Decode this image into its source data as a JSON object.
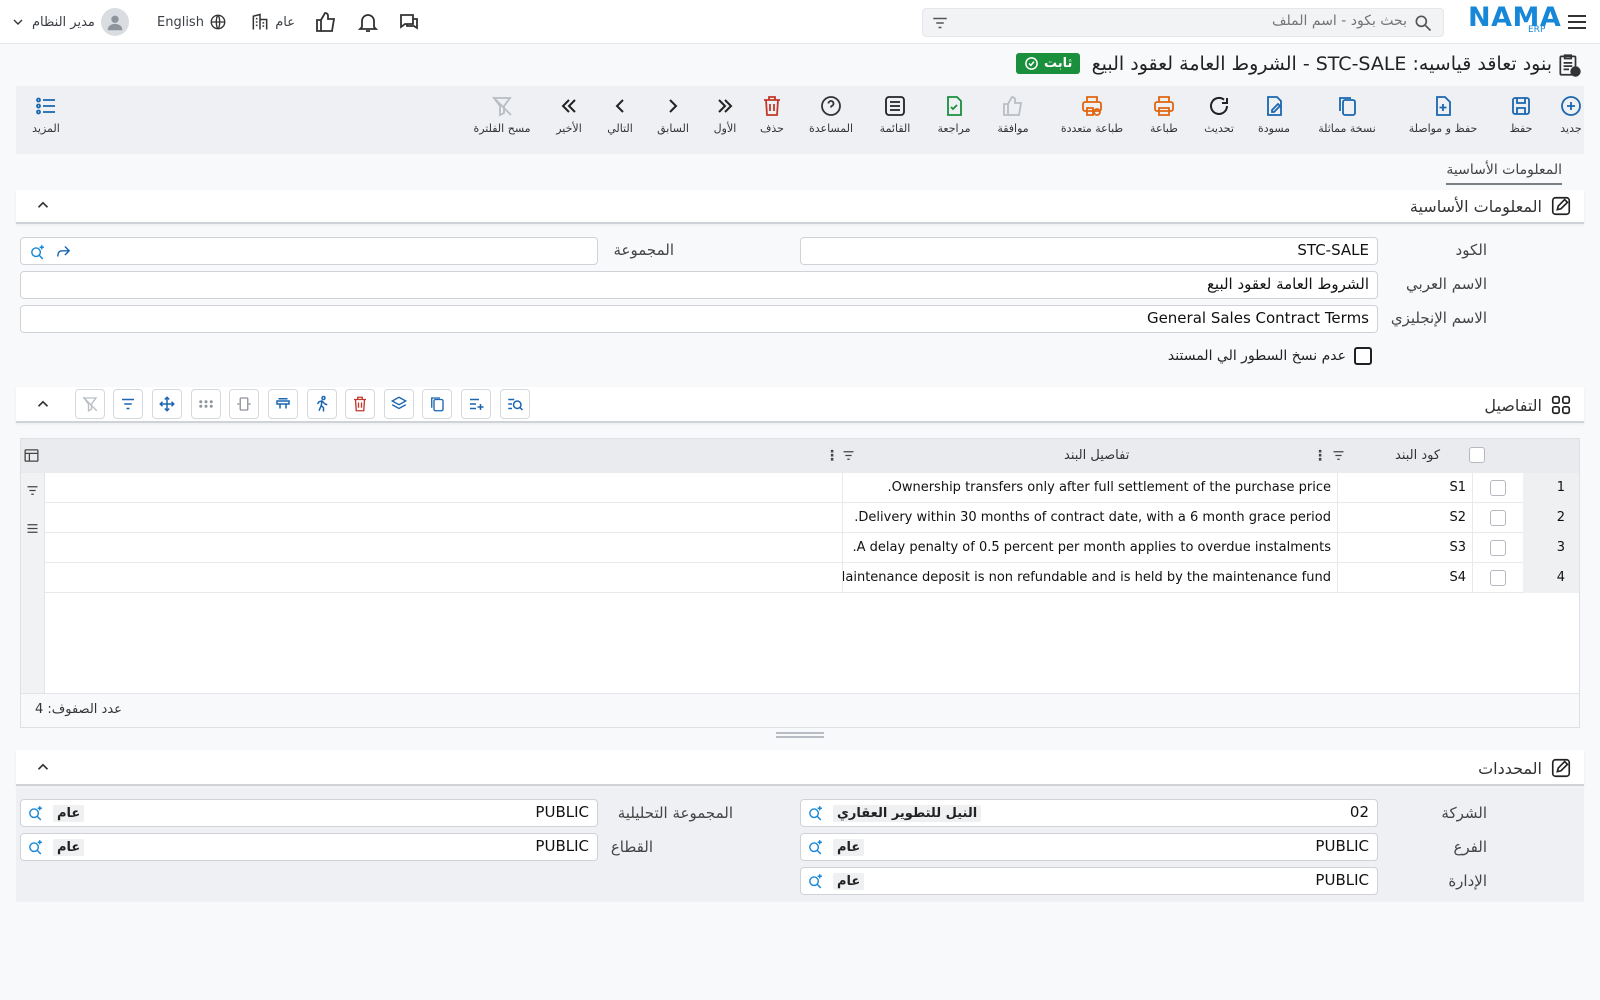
{
  "app": {
    "logo": "NAMA",
    "logo_sub": "ERP"
  },
  "search": {
    "placeholder": "بحث بكود - اسم الملف"
  },
  "topbar": {
    "language": "English",
    "company_short": "عام",
    "user": "مدير النظام"
  },
  "page": {
    "title": "بنود تعاقد قياسيه: STC-SALE - الشروط العامة لعقود البيع",
    "status_badge": "ثابت"
  },
  "toolbar": {
    "new": "جديد",
    "save": "حفظ",
    "save_continue": "حفظ و مواصلة",
    "duplicate": "نسخة مماثلة",
    "draft": "مسودة",
    "refresh": "تحديث",
    "print": "طباعة",
    "multi_print": "طباعة متعددة",
    "approve": "موافقة",
    "review": "مراجعة",
    "list": "القائمة",
    "help": "المساعدة",
    "delete": "حذف",
    "first": "الأول",
    "previous": "السابق",
    "next": "التالي",
    "last": "الأخير",
    "clear_filter": "مسح الفلترة",
    "more": "المزيد"
  },
  "tabs": {
    "basic_info": "المعلومات الأساسية"
  },
  "basic_section": {
    "title": "المعلومات الأساسية",
    "code_label": "الكود",
    "code_value": "STC-SALE",
    "group_label": "المجموعة",
    "group_value": "",
    "arabic_name_label": "الاسم العربي",
    "arabic_name_value": "الشروط العامة لعقود البيع",
    "english_name_label": "الاسم الإنجليزي",
    "english_name_value": "General Sales Contract Terms",
    "no_copy_lines_label": "عدم نسخ السطور الي المستند"
  },
  "details_section": {
    "title": "التفاصيل",
    "columns": {
      "code": "كود البند",
      "details": "تفاصيل البند"
    },
    "rows": [
      {
        "num": "1",
        "code": "S1",
        "details": "Ownership transfers only after full settlement of the purchase price."
      },
      {
        "num": "2",
        "code": "S2",
        "details": "Delivery within 30 months of contract date, with a 6 month grace period."
      },
      {
        "num": "3",
        "code": "S3",
        "details": "A delay penalty of 0.5 percent per month applies to overdue instalments."
      },
      {
        "num": "4",
        "code": "S4",
        "details": "Maintenance deposit is non refundable and is held by the maintenance fund."
      }
    ],
    "row_count": "عدد الصفوف: 4"
  },
  "dimensions_section": {
    "title": "المحددات",
    "company_label": "الشركة",
    "company_code": "02",
    "company_name": "النيل للتطوير العقاري",
    "analytic_group_label": "المجموعة التحليلية",
    "analytic_group_code": "PUBLIC",
    "analytic_group_name": "عام",
    "branch_label": "الفرع",
    "branch_code": "PUBLIC",
    "branch_name": "عام",
    "sector_label": "القطاع",
    "sector_code": "PUBLIC",
    "sector_name": "عام",
    "department_label": "الإدارة",
    "department_code": "PUBLIC",
    "department_name": "عام"
  },
  "colors": {
    "brand": "#1787d8",
    "badge": "#1a8f3c",
    "danger": "#c0392b",
    "approve_disabled": "#b9bec4"
  }
}
